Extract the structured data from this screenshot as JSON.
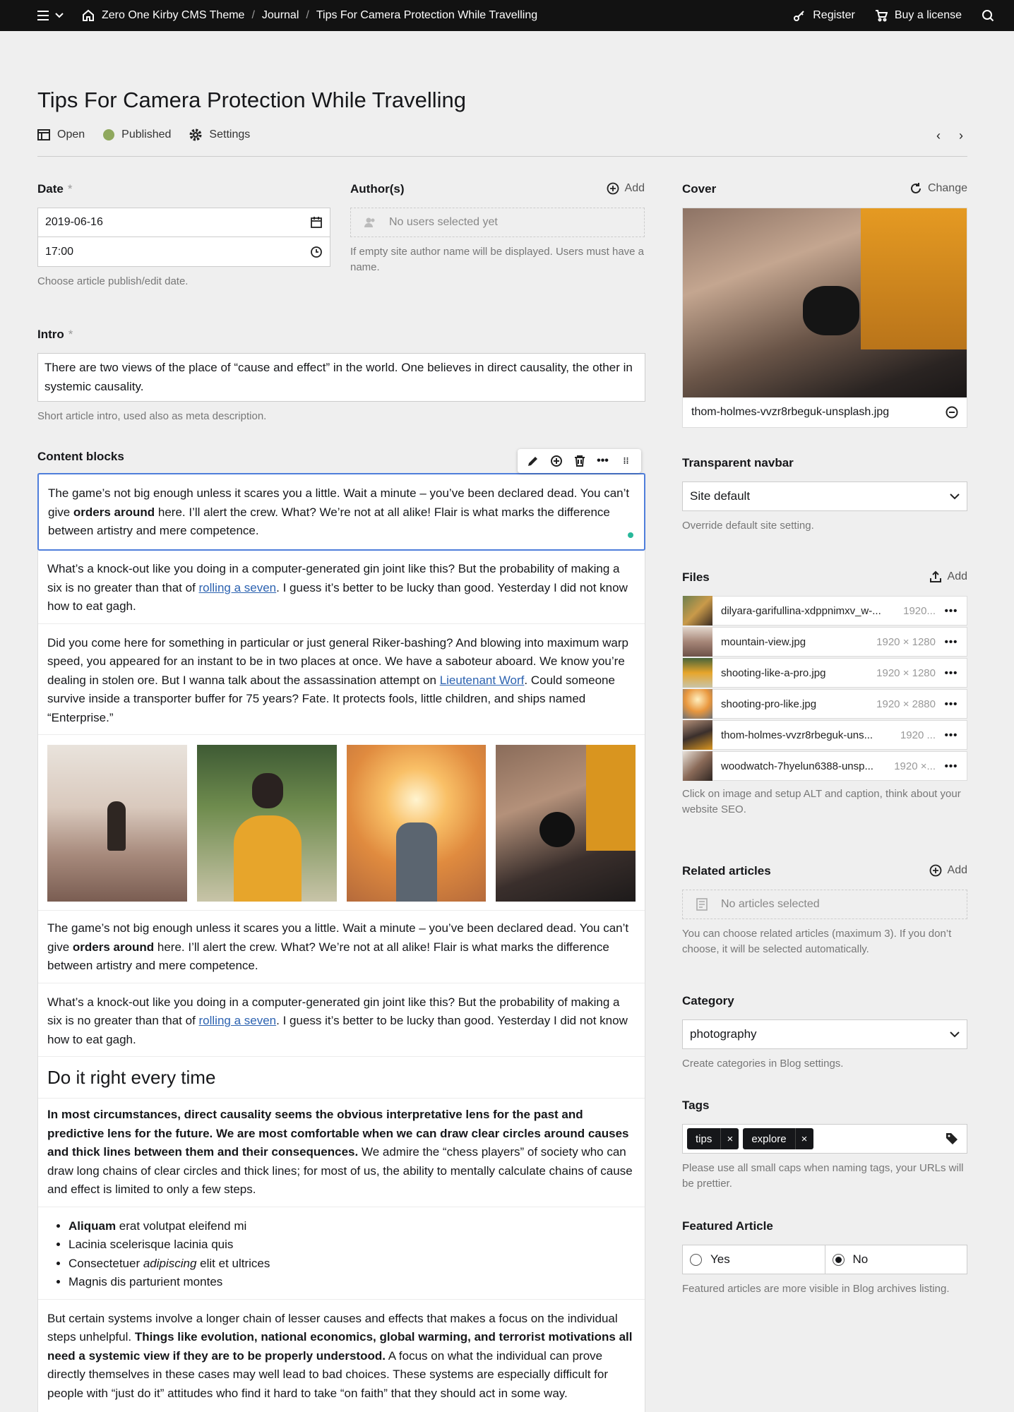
{
  "topbar": {
    "breadcrumbs": [
      "Zero One Kirby CMS Theme",
      "Journal",
      "Tips For Camera Protection While Travelling"
    ],
    "register": "Register",
    "buy": "Buy a license"
  },
  "header": {
    "title": "Tips For Camera Protection While Travelling",
    "open": "Open",
    "status": "Published",
    "settings": "Settings"
  },
  "date": {
    "label": "Date",
    "required": "*",
    "date_value": "2019-06-16",
    "time_value": "17:00",
    "help": "Choose article publish/edit date."
  },
  "authors": {
    "label": "Author(s)",
    "add": "Add",
    "empty": "No users selected yet",
    "help": "If empty site author name will be displayed. Users must have a name."
  },
  "intro": {
    "label": "Intro",
    "required": "*",
    "value": "There are two views of the place of “cause and effect” in the world. One believes in direct causality, the other in systemic causality.",
    "help": "Short article intro, used also as meta description."
  },
  "content": {
    "label": "Content blocks",
    "p1a": "The game’s not big enough unless it scares you a little. Wait a minute – you’ve been declared dead. You can’t give ",
    "p1b": "orders around",
    "p1c": " here. I’ll alert the crew. What? We’re not at all alike! Flair is what marks the difference between artistry and mere competence.",
    "p2a": "What’s a knock-out like you doing in a computer-generated gin joint like this? But the probability of making a six is no greater than that of ",
    "p2link": "rolling a seven",
    "p2c": ". I guess it’s better to be lucky than good. Yesterday I did not know how to eat gagh.",
    "p3a": "Did you come here for something in particular or just general Riker-bashing? And blowing into maximum warp speed, you appeared for an instant to be in two places at once. We have a saboteur aboard. We know you’re dealing in stolen ore. But I wanna talk about the assassination attempt on ",
    "p3link": "Lieutenant Worf",
    "p3c": ". Could someone survive inside a transporter buffer for 75 years? Fate. It protects fools, little children, and ships named “Enterprise.”",
    "heading": "Do it right every time",
    "p6bold": "In most circumstances, direct causality seems the obvious interpretative lens for the past and predictive lens for the future. We are most comfortable when we can draw clear circles around causes and thick lines between them and their consequences.",
    "p6rest": " We admire the “chess players” of society who can draw long chains of clear circles and thick lines; for most of us, the ability to mentally calculate chains of cause and effect is limited to only a few steps.",
    "li1b": "Aliquam",
    "li1r": " erat volutpat eleifend mi",
    "li2": "Lacinia scelerisque lacinia quis",
    "li3a": "Consectetuer ",
    "li3i": "adipiscing",
    "li3c": " elit et ultrices",
    "li4": "Magnis dis parturient montes",
    "p7a": "But certain systems involve a longer chain of lesser causes and effects that makes a focus on the individual steps unhelpful. ",
    "p7b": "Things like evolution, national economics, global warming, and terrorist motivations all need a systemic view if they are to be properly understood.",
    "p7c": " A focus on what the individual can prove directly themselves in these cases may well lead to bad choices. These systems are especially difficult for people with “just do it” attitudes who find it hard to take “on faith” that they should act in some way."
  },
  "cover": {
    "label": "Cover",
    "change": "Change",
    "filename": "thom-holmes-vvzr8rbeguk-unsplash.jpg"
  },
  "navbar": {
    "label": "Transparent navbar",
    "value": "Site default",
    "help": "Override default site setting."
  },
  "files": {
    "label": "Files",
    "add": "Add",
    "items": [
      {
        "name": "dilyara-garifullina-xdppnimxv_w-...",
        "dim": "1920..."
      },
      {
        "name": "mountain-view.jpg",
        "dim": "1920 × 1280"
      },
      {
        "name": "shooting-like-a-pro.jpg",
        "dim": "1920 × 1280"
      },
      {
        "name": "shooting-pro-like.jpg",
        "dim": "1920 × 2880"
      },
      {
        "name": "thom-holmes-vvzr8rbeguk-uns...",
        "dim": "1920 ..."
      },
      {
        "name": "woodwatch-7hyelun6388-unsp...",
        "dim": "1920 ×..."
      }
    ],
    "help": "Click on image and setup ALT and caption, think about your website SEO."
  },
  "related": {
    "label": "Related articles",
    "add": "Add",
    "empty": "No articles selected",
    "help": "You can choose related articles (maximum 3). If you don’t choose, it will be selected automatically."
  },
  "category": {
    "label": "Category",
    "value": "photography",
    "help": "Create categories in Blog settings."
  },
  "tags": {
    "label": "Tags",
    "items": [
      "tips",
      "explore"
    ],
    "help": "Please use all small caps when naming tags, your URLs will be prettier."
  },
  "featured": {
    "label": "Featured Article",
    "yes": "Yes",
    "no": "No",
    "selected": "No",
    "help": "Featured articles are more visible in Blog archives listing."
  },
  "colors": {
    "accent": "#4f7edb",
    "published": "#8fa85d",
    "dark": "#121212"
  }
}
